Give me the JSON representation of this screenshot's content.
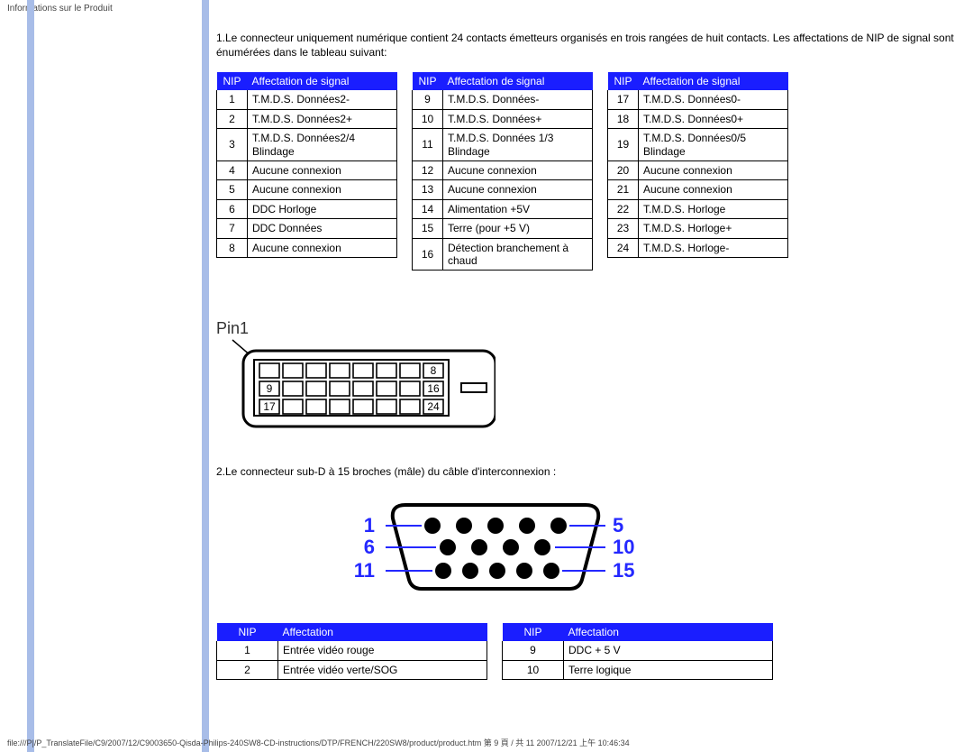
{
  "header": "Informations sur le Produit",
  "footer": "file:///P|/P_TranslateFile/C9/2007/12/C9003650-Qisda-Philips-240SW8-CD-instructions/DTP/FRENCH/220SW8/product/product.htm 第 9 頁 / 共 11 2007/12/21 上午 10:46:34",
  "paragraphs": {
    "p1": "1.Le connecteur uniquement numérique contient 24 contacts émetteurs organisés en trois rangées de huit contacts. Les affectations de NIP de signal sont énumérées dans le tableau suivant:",
    "p2": "2.Le connecteur sub-D à 15 broches (mâle) du câble d'interconnexion :"
  },
  "table_headers": {
    "nip": "NIP",
    "aff_signal": "Affectation de signal",
    "aff": "Affectation"
  },
  "dvi_label": "Pin1",
  "dvi_pins": {
    "p8": "8",
    "p9": "9",
    "p16": "16",
    "p17": "17",
    "p24": "24"
  },
  "vga_nums": {
    "n1": "1",
    "n5": "5",
    "n6": "6",
    "n10": "10",
    "n11": "11",
    "n15": "15"
  },
  "t1": [
    {
      "n": "1",
      "a": "T.M.D.S. Données2-"
    },
    {
      "n": "2",
      "a": "T.M.D.S. Données2+"
    },
    {
      "n": "3",
      "a": "T.M.D.S. Données2/4 Blindage"
    },
    {
      "n": "4",
      "a": "Aucune connexion"
    },
    {
      "n": "5",
      "a": "Aucune connexion"
    },
    {
      "n": "6",
      "a": "DDC Horloge"
    },
    {
      "n": "7",
      "a": "DDC Données"
    },
    {
      "n": "8",
      "a": "Aucune connexion"
    }
  ],
  "t2": [
    {
      "n": "9",
      "a": "T.M.D.S. Données-"
    },
    {
      "n": "10",
      "a": "T.M.D.S. Données+"
    },
    {
      "n": "11",
      "a": "T.M.D.S. Données 1/3 Blindage"
    },
    {
      "n": "12",
      "a": "Aucune connexion"
    },
    {
      "n": "13",
      "a": "Aucune connexion"
    },
    {
      "n": "14",
      "a": "Alimentation +5V"
    },
    {
      "n": "15",
      "a": "Terre (pour +5 V)"
    },
    {
      "n": "16",
      "a": "Détection branchement à chaud"
    }
  ],
  "t3": [
    {
      "n": "17",
      "a": "T.M.D.S. Données0-"
    },
    {
      "n": "18",
      "a": "T.M.D.S. Données0+"
    },
    {
      "n": "19",
      "a": "T.M.D.S. Données0/5 Blindage"
    },
    {
      "n": "20",
      "a": "Aucune connexion"
    },
    {
      "n": "21",
      "a": "Aucune connexion"
    },
    {
      "n": "22",
      "a": "T.M.D.S. Horloge"
    },
    {
      "n": "23",
      "a": "T.M.D.S. Horloge+"
    },
    {
      "n": "24",
      "a": "T.M.D.S. Horloge-"
    }
  ],
  "t4": [
    {
      "n": "1",
      "a": "Entrée vidéo rouge"
    },
    {
      "n": "2",
      "a": "Entrée vidéo verte/SOG"
    }
  ],
  "t5": [
    {
      "n": "9",
      "a": "DDC + 5 V"
    },
    {
      "n": "10",
      "a": "Terre logique"
    }
  ]
}
